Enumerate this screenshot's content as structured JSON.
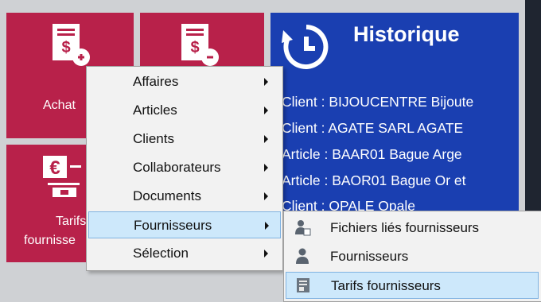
{
  "tiles": {
    "achats": {
      "label": "Achat"
    },
    "tarifs": {
      "label_line1": "Tarifs",
      "label_line2": "fournisse"
    }
  },
  "history": {
    "title": "Historique",
    "items": [
      "Client : BIJOUCENTRE Bijoute",
      "Client : AGATE SARL AGATE",
      "Article : BAAR01 Bague Arge",
      "Article : BAOR01 Bague Or et",
      "Client : OPALE Opale"
    ]
  },
  "context_menu": {
    "items": [
      {
        "label": "Affaires"
      },
      {
        "label": "Articles"
      },
      {
        "label": "Clients"
      },
      {
        "label": "Collaborateurs"
      },
      {
        "label": "Documents"
      },
      {
        "label": "Fournisseurs"
      },
      {
        "label": "Sélection"
      }
    ],
    "highlighted": "Fournisseurs"
  },
  "submenu": {
    "items": [
      {
        "label": "Fichiers liés fournisseurs",
        "icon": "person-document-icon"
      },
      {
        "label": "Fournisseurs",
        "icon": "person-icon"
      },
      {
        "label": "Tarifs fournisseurs",
        "icon": "price-list-icon"
      }
    ],
    "highlighted": "Tarifs fournisseurs"
  },
  "colors": {
    "tile_red": "#b8214a",
    "history_blue": "#1a3fb1",
    "highlight": "#cde8fb",
    "highlight_border": "#7fb2e1"
  }
}
